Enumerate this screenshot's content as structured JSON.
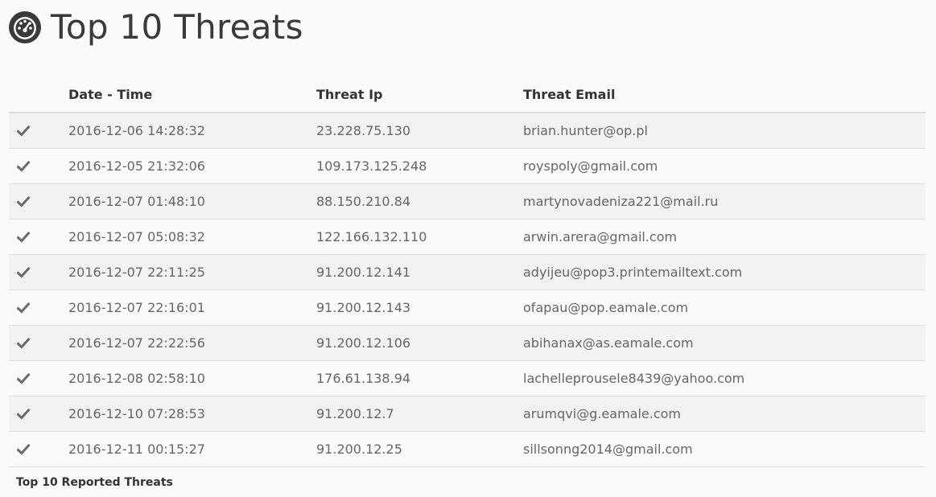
{
  "header": {
    "title": "Top 10 Threats",
    "icon": "dashboard-gauge-icon"
  },
  "table": {
    "columns": [
      "",
      "Date - Time",
      "Threat Ip",
      "Threat Email"
    ],
    "rows": [
      {
        "datetime": "2016-12-06 14:28:32",
        "ip": "23.228.75.130",
        "email": "brian.hunter@op.pl"
      },
      {
        "datetime": "2016-12-05 21:32:06",
        "ip": "109.173.125.248",
        "email": "royspoly@gmail.com"
      },
      {
        "datetime": "2016-12-07 01:48:10",
        "ip": "88.150.210.84",
        "email": "martynovadeniza221@mail.ru"
      },
      {
        "datetime": "2016-12-07 05:08:32",
        "ip": "122.166.132.110",
        "email": "arwin.arera@gmail.com"
      },
      {
        "datetime": "2016-12-07 22:11:25",
        "ip": "91.200.12.141",
        "email": "adyijeu@pop3.printemailtext.com"
      },
      {
        "datetime": "2016-12-07 22:16:01",
        "ip": "91.200.12.143",
        "email": "ofapau@pop.eamale.com"
      },
      {
        "datetime": "2016-12-07 22:22:56",
        "ip": "91.200.12.106",
        "email": "abihanax@as.eamale.com"
      },
      {
        "datetime": "2016-12-08 02:58:10",
        "ip": "176.61.138.94",
        "email": "lachelleprousele8439@yahoo.com"
      },
      {
        "datetime": "2016-12-10 07:28:53",
        "ip": "91.200.12.7",
        "email": "arumqvi@g.eamale.com"
      },
      {
        "datetime": "2016-12-11 00:15:27",
        "ip": "91.200.12.25",
        "email": "sillsonng2014@gmail.com"
      }
    ],
    "caption": "Top 10 Reported Threats"
  }
}
